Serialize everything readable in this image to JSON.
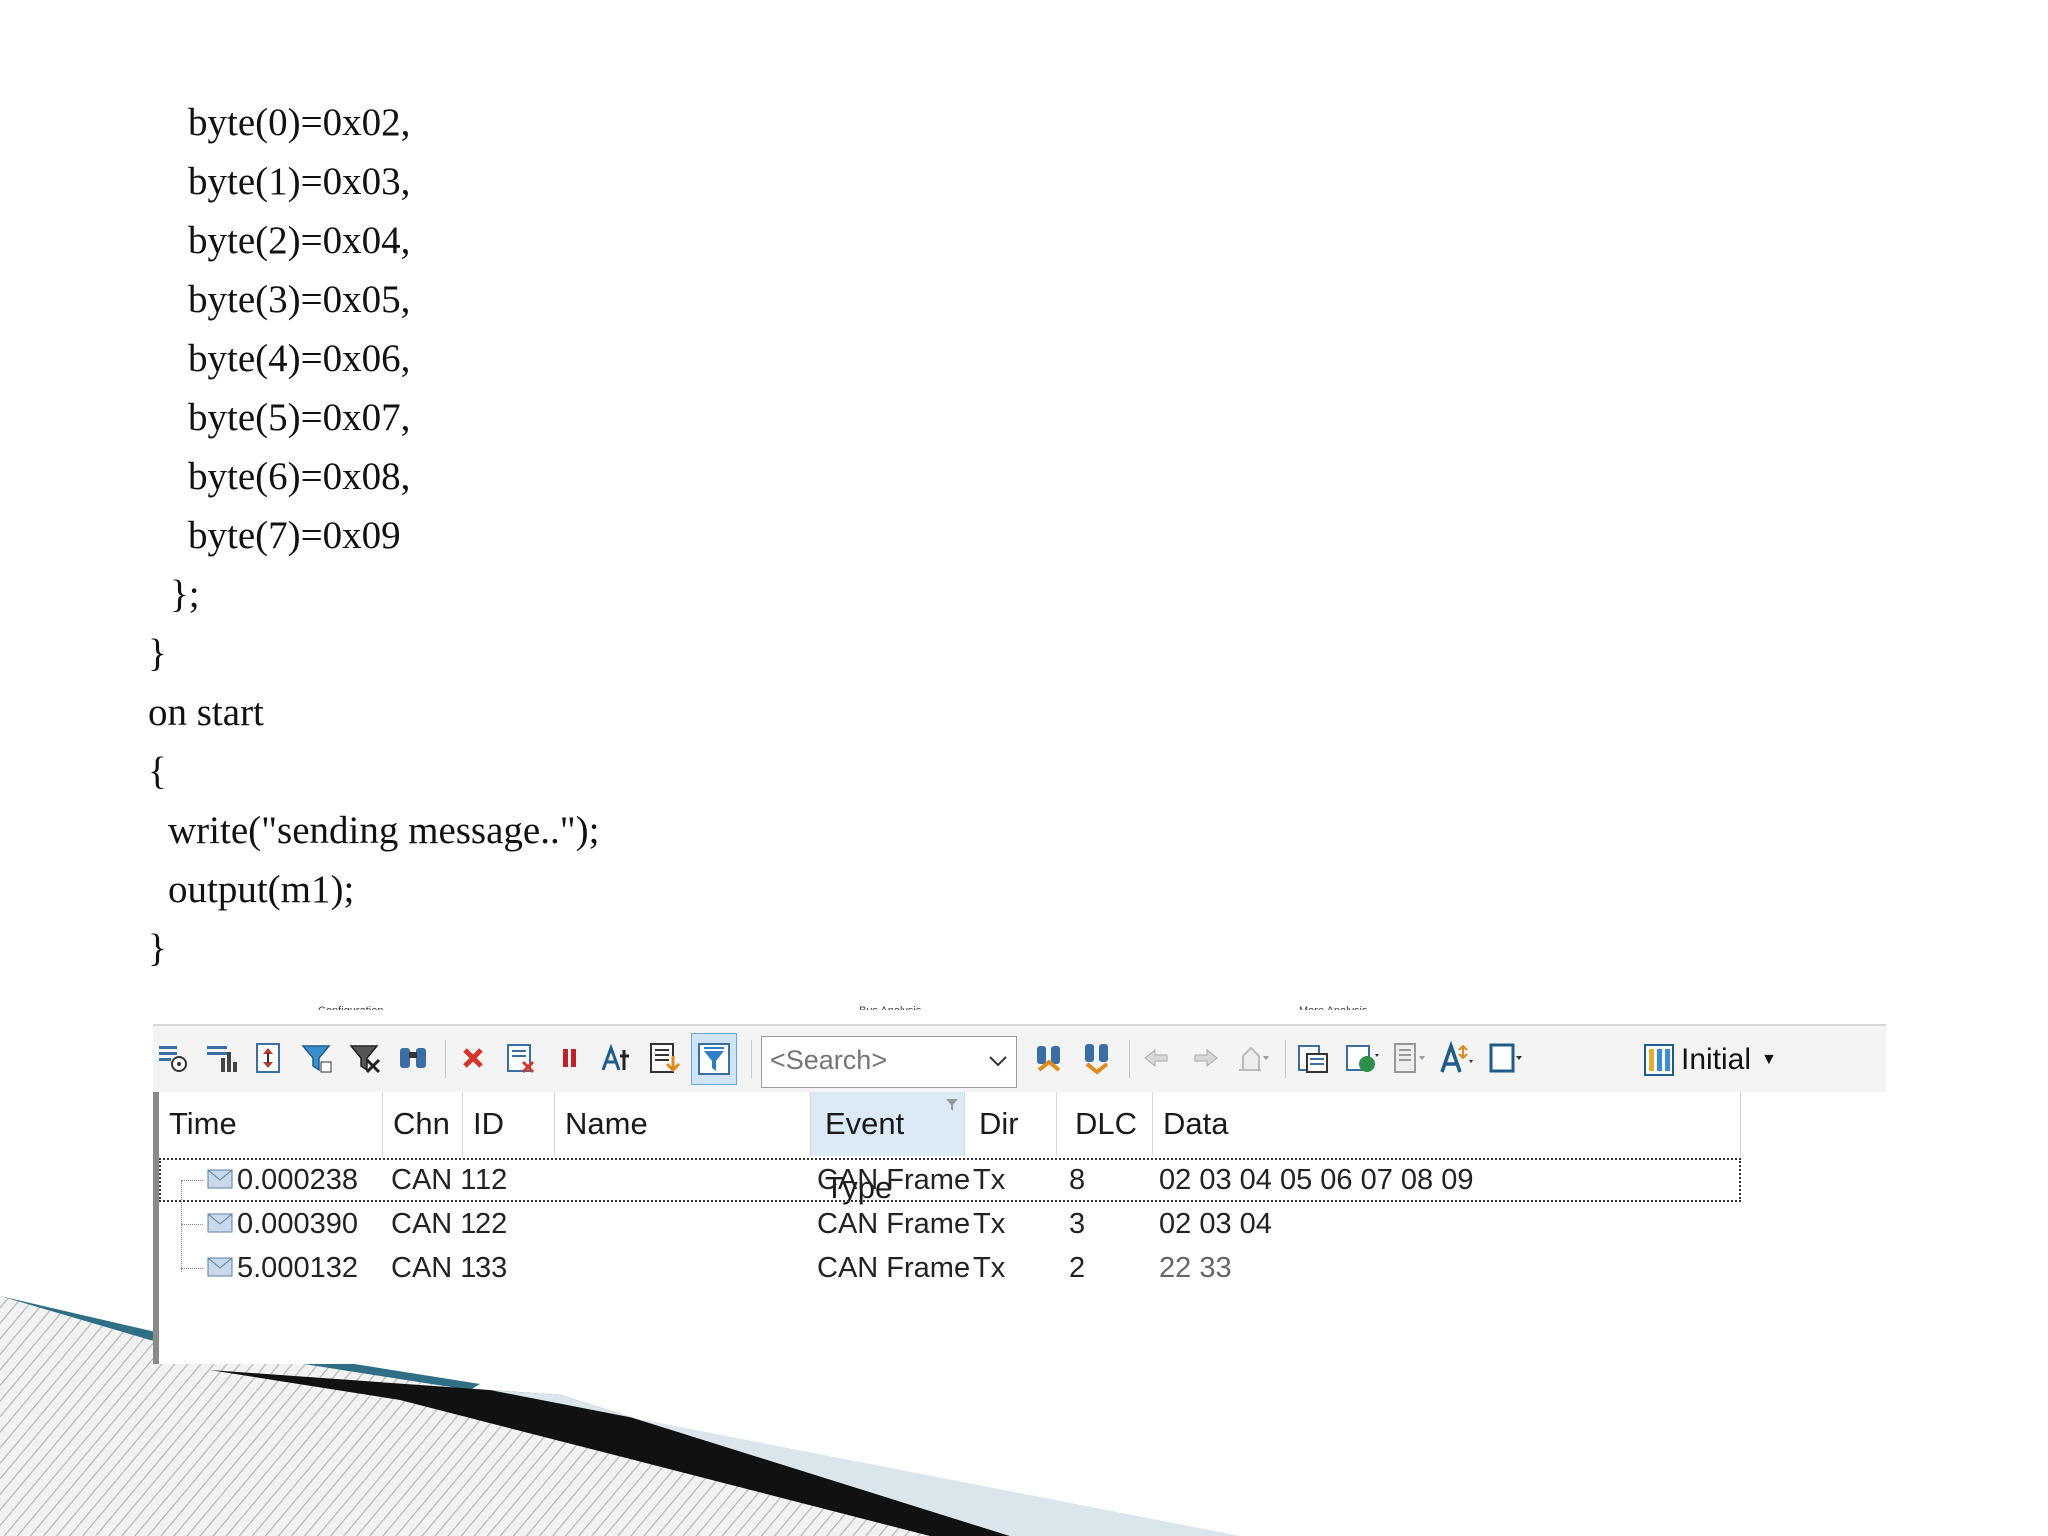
{
  "code": {
    "lines": [
      "byte(0)=0x02,",
      "byte(1)=0x03,",
      "byte(2)=0x04,",
      "byte(3)=0x05,",
      "byte(4)=0x06,",
      "byte(5)=0x07,",
      "byte(6)=0x08,",
      "byte(7)=0x09",
      "};",
      "}",
      "on start",
      "{",
      "write(\"sending message..\");",
      "output(m1);",
      "}"
    ]
  },
  "ribbon": {
    "groups": [
      "Configuration",
      "Bus Analysis",
      "More Analysis"
    ]
  },
  "toolbar": {
    "search_placeholder": "<Search>",
    "initial_label": "Initial",
    "icons": [
      "new-window-icon",
      "statistics-icon",
      "scroll-icon",
      "filter-icon",
      "remove-filter-icon",
      "find-icon",
      "clear-icon",
      "clear-selected-icon",
      "pause-icon",
      "time-format-icon",
      "detail-view-icon",
      "analysis-filter-icon",
      "find-next-icon",
      "find-previous-icon",
      "back-icon",
      "forward-icon",
      "marker-icon",
      "copy-icon",
      "export-icon",
      "layout-icon",
      "font-icon",
      "window-icon",
      "columns-icon"
    ]
  },
  "trace": {
    "columns": [
      "Time",
      "Chn",
      "ID",
      "Name",
      "Event Type",
      "Dir",
      "DLC",
      "Data"
    ],
    "rows": [
      {
        "time": "0.000238",
        "chn": "CAN 1",
        "id": "12",
        "name": "",
        "event_type": "CAN Frame",
        "dir": "Tx",
        "dlc": "8",
        "data": "02 03 04 05 06 07 08 09"
      },
      {
        "time": "0.000390",
        "chn": "CAN 1",
        "id": "22",
        "name": "",
        "event_type": "CAN Frame",
        "dir": "Tx",
        "dlc": "3",
        "data": "02 03 04"
      },
      {
        "time": "5.000132",
        "chn": "CAN 1",
        "id": "33",
        "name": "",
        "event_type": "CAN Frame",
        "dir": "Tx",
        "dlc": "2",
        "data": "22 33"
      }
    ]
  },
  "colors": {
    "selected_header": "#dceaf8",
    "active_tool": "#cfe4f7",
    "deco_dark": "#0d1b2a",
    "deco_teal": "#2f6f86"
  }
}
